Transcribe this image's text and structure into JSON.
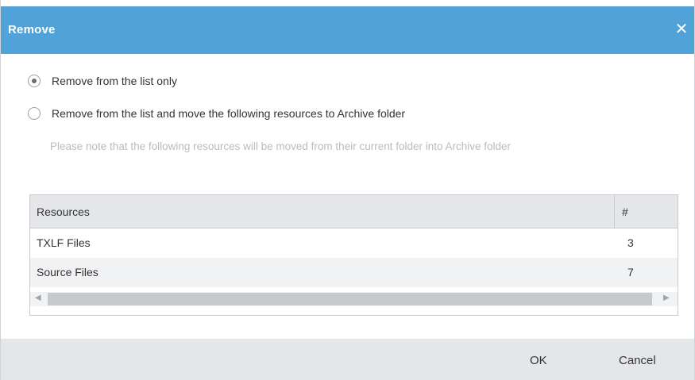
{
  "dialog": {
    "title": "Remove",
    "close_icon": "close-icon",
    "close_glyph": "✕"
  },
  "options": [
    {
      "label": "Remove from the list only",
      "selected": true
    },
    {
      "label": "Remove from the list and move the following resources to Archive folder",
      "selected": false
    }
  ],
  "note": "Please note that the following resources will be moved from their current folder into Archive folder",
  "table": {
    "headers": [
      "Resources",
      "#"
    ],
    "rows": [
      {
        "name": "TXLF Files",
        "count": "3"
      },
      {
        "name": "Source Files",
        "count": "7"
      }
    ],
    "scroll_left_glyph": "◀",
    "scroll_right_glyph": "▶"
  },
  "footer": {
    "ok_label": "OK",
    "cancel_label": "Cancel"
  },
  "colors": {
    "titlebar": "#51a2d8",
    "footer": "#e4e6ea",
    "note_text": "#b8bcc0"
  }
}
